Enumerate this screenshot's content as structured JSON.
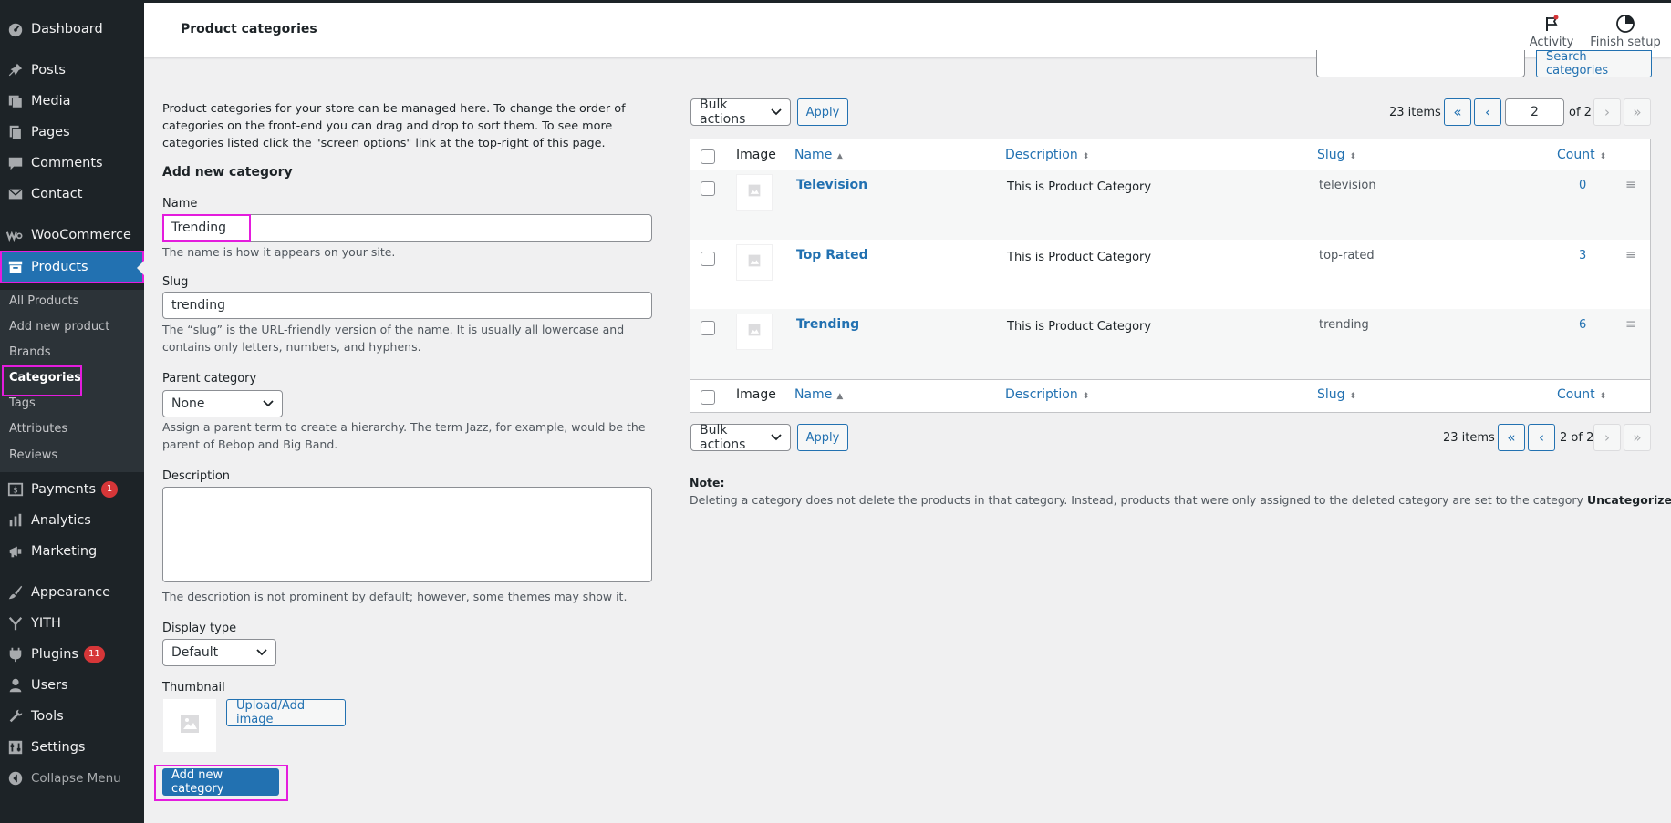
{
  "sidebar": {
    "items": [
      {
        "label": "Dashboard",
        "icon": "dashboard-icon"
      },
      {
        "label": "Posts",
        "icon": "pin-icon"
      },
      {
        "label": "Media",
        "icon": "media-icon"
      },
      {
        "label": "Pages",
        "icon": "pages-icon"
      },
      {
        "label": "Comments",
        "icon": "comment-icon"
      },
      {
        "label": "Contact",
        "icon": "mail-icon"
      },
      {
        "label": "WooCommerce",
        "icon": "woo-icon"
      },
      {
        "label": "Products",
        "icon": "archive-icon"
      },
      {
        "label": "Payments",
        "icon": "dollar-icon",
        "badge": "1"
      },
      {
        "label": "Analytics",
        "icon": "chart-icon"
      },
      {
        "label": "Marketing",
        "icon": "megaphone-icon"
      },
      {
        "label": "Appearance",
        "icon": "brush-icon"
      },
      {
        "label": "YITH",
        "icon": "yith-icon"
      },
      {
        "label": "Plugins",
        "icon": "plugin-icon",
        "badge": "11"
      },
      {
        "label": "Users",
        "icon": "user-icon"
      },
      {
        "label": "Tools",
        "icon": "wrench-icon"
      },
      {
        "label": "Settings",
        "icon": "settings-icon"
      },
      {
        "label": "Collapse Menu",
        "icon": "collapse-icon"
      }
    ],
    "submenu": [
      "All Products",
      "Add new product",
      "Brands",
      "Categories",
      "Tags",
      "Attributes",
      "Reviews"
    ]
  },
  "topbar": {
    "title": "Product categories",
    "activity": "Activity",
    "finish_setup": "Finish setup"
  },
  "search": {
    "button": "Search categories",
    "value": ""
  },
  "form": {
    "intro": "Product categories for your store can be managed here. To change the order of categories on the front-end you can drag and drop to sort them. To see more categories listed click the \"screen options\" link at the top-right of this page.",
    "heading": "Add new category",
    "name_label": "Name",
    "name_value": "Trending",
    "name_help": "The name is how it appears on your site.",
    "slug_label": "Slug",
    "slug_value": "trending",
    "slug_help": "The “slug” is the URL-friendly version of the name. It is usually all lowercase and contains only letters, numbers, and hyphens.",
    "parent_label": "Parent category",
    "parent_value": "None",
    "parent_help": "Assign a parent term to create a hierarchy. The term Jazz, for example, would be the parent of Bebop and Big Band.",
    "description_label": "Description",
    "description_value": "",
    "description_help": "The description is not prominent by default; however, some themes may show it.",
    "display_label": "Display type",
    "display_value": "Default",
    "thumbnail_label": "Thumbnail",
    "upload_button": "Upload/Add image",
    "submit_button": "Add new category"
  },
  "list": {
    "bulk_actions": "Bulk actions",
    "apply": "Apply",
    "items_count": "23 items",
    "current_page": "2",
    "of_pages": "of 2",
    "bottom_page": "2 of 2",
    "columns": {
      "image": "Image",
      "name": "Name",
      "description": "Description",
      "slug": "Slug",
      "count": "Count"
    },
    "rows": [
      {
        "name": "Television",
        "description": "This is Product Category",
        "slug": "television",
        "count": "0"
      },
      {
        "name": "Top Rated",
        "description": "This is Product Category",
        "slug": "top-rated",
        "count": "3"
      },
      {
        "name": "Trending",
        "description": "This is Product Category",
        "slug": "trending",
        "count": "6"
      }
    ],
    "note_label": "Note:",
    "note_text": "Deleting a category does not delete the products in that category. Instead, products that were only assigned to the deleted category are set to the category",
    "note_bold": "Uncategorized",
    "note_end": "."
  },
  "colors": {
    "accent": "#2271b1",
    "sidebar": "#1d2327",
    "highlight": "#e41cdd",
    "badge": "#d63638"
  }
}
